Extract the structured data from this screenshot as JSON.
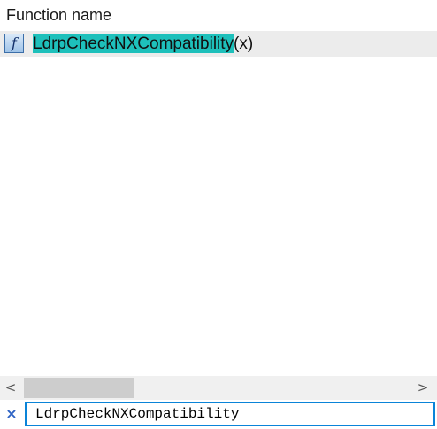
{
  "header": {
    "column_title": "Function name"
  },
  "list": {
    "items": [
      {
        "icon": "function-icon",
        "icon_glyph": "f",
        "name_highlighted": "LdrpCheckNXCompatibility",
        "suffix": "(x)"
      }
    ]
  },
  "scrollbar": {
    "left_arrow": "<",
    "right_arrow": ">"
  },
  "filter": {
    "clear_icon": "×",
    "value": "LdrpCheckNXCompatibility"
  },
  "colors": {
    "highlight": "#1ec0bb",
    "selected_row": "#ececec",
    "input_border": "#0a84d8",
    "clear_icon": "#2e63c4"
  }
}
